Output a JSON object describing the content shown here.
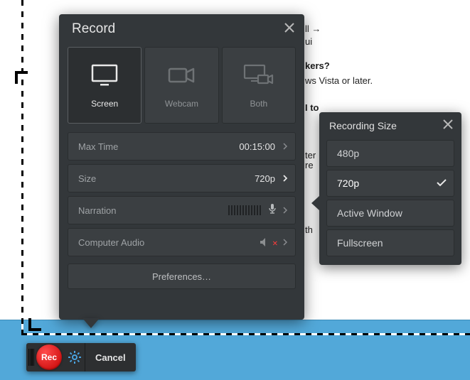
{
  "background_text": {
    "b1": "ll →",
    "b2": "ui",
    "b3": "kers?",
    "b4": "ws Vista or later.",
    "b5": "",
    "b6": "I to",
    "b7": "ter",
    "b8": "re",
    "b10": "th"
  },
  "panel": {
    "title": "Record",
    "sources": {
      "screen": "Screen",
      "webcam": "Webcam",
      "both": "Both"
    },
    "rows": {
      "max_time": {
        "label": "Max Time",
        "value": "00:15:00"
      },
      "size": {
        "label": "Size",
        "value": "720p"
      },
      "narration": {
        "label": "Narration"
      },
      "computer_audio": {
        "label": "Computer Audio"
      }
    },
    "prefs": "Preferences…"
  },
  "popup": {
    "title": "Recording Size",
    "items": [
      "480p",
      "720p",
      "Active Window",
      "Fullscreen"
    ],
    "selected_index": 1
  },
  "ctrl": {
    "rec": "Rec",
    "cancel": "Cancel"
  }
}
